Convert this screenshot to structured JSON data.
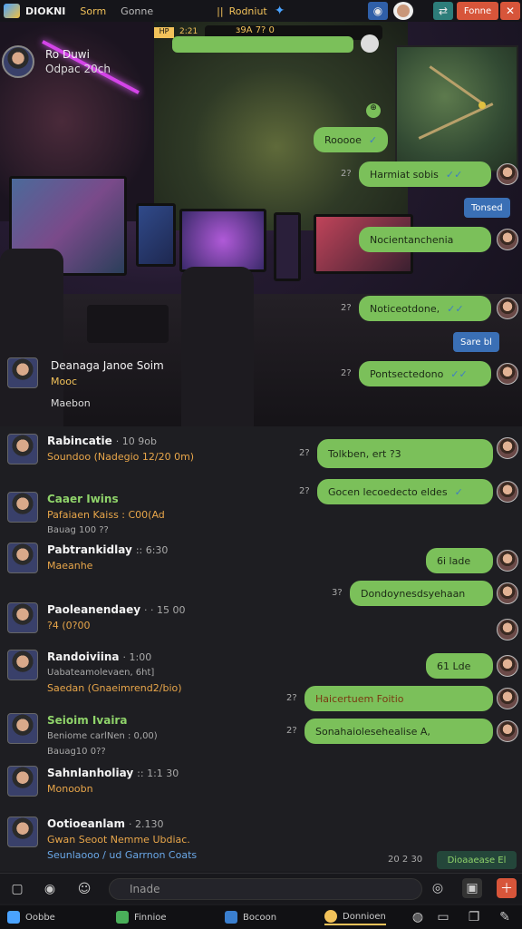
{
  "topbar": {
    "app": "DIOKNI",
    "tab1": "Sorm",
    "tab2": "Gonne",
    "tab3": "||",
    "tab4": "Rodniut",
    "close_btn": "Fonne"
  },
  "stream": {
    "host_line1": "Ro Duwi",
    "host_line2": "Odpac 20ch",
    "badge1": "HP",
    "badge2": "2:21",
    "badge3": "·",
    "counter": "ɜ9A 7? 0"
  },
  "bubbles": [
    {
      "text": "Rooooe",
      "ts": ""
    },
    {
      "text": "Harmiat sobis",
      "ts": "2?"
    },
    {
      "text": "Nocientanchenia",
      "ts": ""
    },
    {
      "text": "Noticeotdone,",
      "ts": "2?"
    },
    {
      "text": "Pontsectedono",
      "ts": "2?"
    },
    {
      "text": "Tolkben, ert ?3",
      "ts": "2?"
    },
    {
      "text": "Gocen lecoedecto eldes",
      "ts": "2?"
    },
    {
      "text": "6i lade",
      "ts": ""
    },
    {
      "text": "Dondoynesdsyehaan",
      "ts": "3?"
    },
    {
      "text": "61 Lde",
      "ts": ""
    },
    {
      "text": "Haicertuem Foitio",
      "ts": "2?"
    },
    {
      "text": "Sonahaiolesehealise A,",
      "ts": "2?"
    }
  ],
  "tags": {
    "t1": "Tonsed",
    "t2": "Sare bl"
  },
  "streamer_info": {
    "name": "Deanaga Janoe Soim",
    "line2": "Mooc",
    "line3": "Maebon"
  },
  "chats": [
    {
      "name": "Rabincatie",
      "meta": "· 10 9ob",
      "sub": "Soundoo (Nadegio 12/20 0m)",
      "sub2": ""
    },
    {
      "name": "Caaer Iwins",
      "meta": "",
      "sub": "Pafaiaen Kaiss : C00(Ad",
      "sub2": "Bauag 100 ??"
    },
    {
      "name": "Pabtrankidlay",
      "meta": ":: 6:30",
      "sub": "Maeanhe",
      "sub2": ""
    },
    {
      "name": "Paoleanendaey",
      "meta": "· · 15 00",
      "sub": "?4 (0?00",
      "sub2": ""
    },
    {
      "name": "Randoiviina",
      "meta": "· 1:00",
      "sub": "Uabateamolevaen, 6ht]",
      "sub2": "Saedan (Gnaeimrend2/bio)"
    },
    {
      "name": "Seioim Ivaira",
      "meta": "",
      "sub": "Beniome carlNen : 0,00)",
      "sub2": "Bauag10 0??"
    },
    {
      "name": "Sahnlanholiay",
      "meta": ":: 1:1 30",
      "sub": "Monoobn",
      "sub2": ""
    },
    {
      "name": "Ootioeanlam",
      "meta": "· 2.130",
      "sub": "Gwan Seoot Nemme Ubdiac.",
      "sub2": "Seunlaooo / ud Garrnon Coats"
    }
  ],
  "footer_btn": "Dioaaease El",
  "footer_ts": "20 2 30",
  "input": {
    "placeholder": "Inade"
  },
  "taskbar": {
    "t1": "Oobbe",
    "t2": "Finnioe",
    "t3": "Bocoon",
    "t4": "Donnioen"
  }
}
